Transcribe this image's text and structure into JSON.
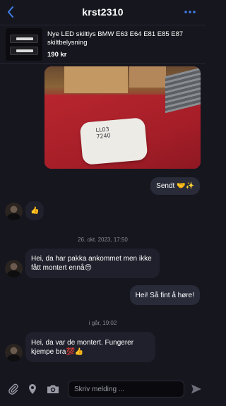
{
  "header": {
    "title": "krst2310"
  },
  "listing": {
    "title": "Nye LED skiltlys BMW E63 E64 E81 E85 E87 skiltbelysning",
    "price": "190 kr"
  },
  "photo": {
    "bag_label_line1": "LL03",
    "bag_label_line2": "7240"
  },
  "messages": [
    {
      "direction": "out",
      "text": "Sendt 🤝✨"
    },
    {
      "direction": "in",
      "text": "👍"
    },
    {
      "type": "timestamp",
      "text": "26. okt. 2023, 17:50"
    },
    {
      "direction": "in",
      "text": "Hei, da har pakka ankommet men ikke fått montert ennå😔"
    },
    {
      "direction": "out",
      "text": "Hei! Så fint å høre!"
    },
    {
      "type": "timestamp",
      "text": "i går, 19:02"
    },
    {
      "direction": "in",
      "text": "Hei, da var de montert. Fungerer kjempe bra💯👍"
    }
  ],
  "composer": {
    "placeholder": "Skriv melding ..."
  },
  "colors": {
    "background": "#16161f",
    "accent": "#3f7ee8",
    "outgoing_bubble": "#292b39",
    "incoming_bubble": "#1f202b"
  },
  "icons": [
    "chevron-left-icon",
    "more-dots-icon",
    "paperclip-icon",
    "location-pin-icon",
    "camera-icon",
    "send-icon"
  ]
}
